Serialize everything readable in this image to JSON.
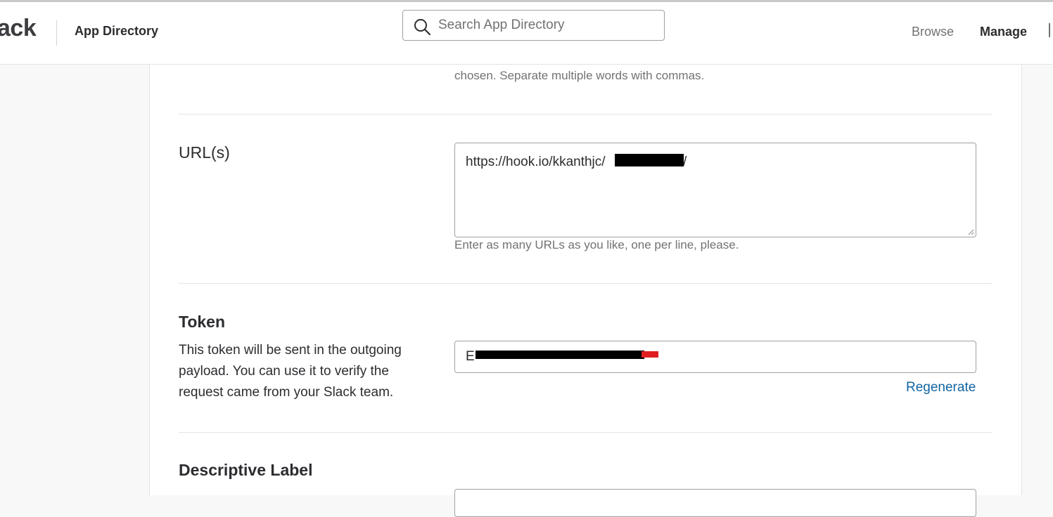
{
  "header": {
    "logo_text": "ack",
    "section_title": "App Directory",
    "search": {
      "placeholder": "Search App Directory",
      "value": ""
    },
    "nav": {
      "browse": "Browse",
      "manage": "Manage"
    }
  },
  "form": {
    "trigger_words": {
      "help_text": "chosen. Separate multiple words with commas."
    },
    "urls": {
      "label": "URL(s)",
      "value": "https://hook.io/kkanthjc/",
      "value_suffix": "/",
      "help_text": "Enter as many URLs as you like, one per line, please."
    },
    "token": {
      "label": "Token",
      "description": "This token will be sent in the outgoing payload. You can use it to verify the request came from your Slack team.",
      "value_prefix": "E",
      "regenerate_label": "Regenerate"
    },
    "descriptive_label": {
      "label": "Descriptive Label"
    }
  },
  "colors": {
    "accent_link": "#1264a3",
    "redaction": "#000000",
    "redaction_red": "#e02020"
  }
}
